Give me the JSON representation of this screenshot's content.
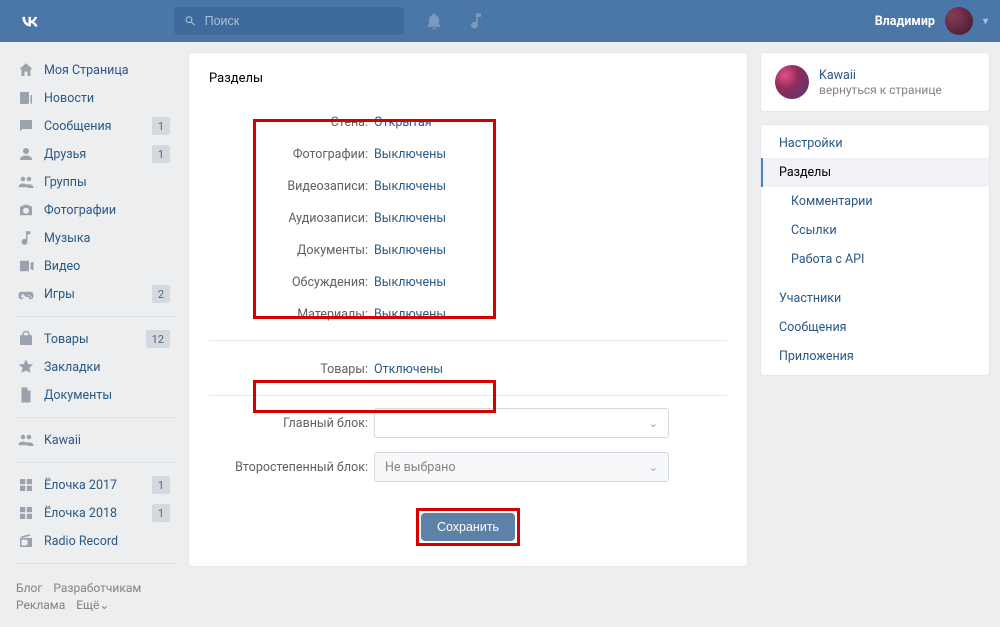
{
  "header": {
    "search_placeholder": "Поиск",
    "user_name": "Владимир"
  },
  "nav": {
    "items": [
      {
        "icon": "home",
        "label": "Моя Страница"
      },
      {
        "icon": "news",
        "label": "Новости"
      },
      {
        "icon": "msg",
        "label": "Сообщения",
        "badge": "1"
      },
      {
        "icon": "friends",
        "label": "Друзья",
        "badge": "1"
      },
      {
        "icon": "groups",
        "label": "Группы"
      },
      {
        "icon": "photo",
        "label": "Фотографии"
      },
      {
        "icon": "music",
        "label": "Музыка"
      },
      {
        "icon": "video",
        "label": "Видео"
      },
      {
        "icon": "games",
        "label": "Игры",
        "badge": "2"
      }
    ],
    "items2": [
      {
        "icon": "bag",
        "label": "Товары",
        "badge": "12"
      },
      {
        "icon": "star",
        "label": "Закладки"
      },
      {
        "icon": "doc",
        "label": "Документы"
      }
    ],
    "items3": [
      {
        "icon": "groups",
        "label": "Kawaii"
      }
    ],
    "items4": [
      {
        "icon": "app",
        "label": "Ёлочка 2017",
        "badge": "1"
      },
      {
        "icon": "app",
        "label": "Ёлочка 2018",
        "badge": "1"
      },
      {
        "icon": "radio",
        "label": "Radio Record"
      }
    ],
    "footer": [
      "Блог",
      "Разработчикам",
      "Реклама",
      "Ещё⌄"
    ]
  },
  "main": {
    "title": "Разделы",
    "settings": [
      {
        "label": "Стена:",
        "value": "Открытая"
      },
      {
        "label": "Фотографии:",
        "value": "Выключены"
      },
      {
        "label": "Видеозаписи:",
        "value": "Выключены"
      },
      {
        "label": "Аудиозаписи:",
        "value": "Выключены"
      },
      {
        "label": "Документы:",
        "value": "Выключены"
      },
      {
        "label": "Обсуждения:",
        "value": "Выключены"
      },
      {
        "label": "Материалы:",
        "value": "Выключены"
      }
    ],
    "goods": {
      "label": "Товары:",
      "value": "Отключены"
    },
    "main_block_label": "Главный блок:",
    "secondary_block_label": "Второстепенный блок:",
    "secondary_placeholder": "Не выбрано",
    "save_label": "Сохранить"
  },
  "side": {
    "profile_name": "Kawaii",
    "profile_sub": "вернуться к странице",
    "menu": [
      {
        "t": "item",
        "label": "Настройки"
      },
      {
        "t": "active",
        "label": "Разделы"
      },
      {
        "t": "sub",
        "label": "Комментарии"
      },
      {
        "t": "sub",
        "label": "Ссылки"
      },
      {
        "t": "sub",
        "label": "Работа с API"
      },
      {
        "t": "gap"
      },
      {
        "t": "item",
        "label": "Участники"
      },
      {
        "t": "item",
        "label": "Сообщения"
      },
      {
        "t": "item",
        "label": "Приложения"
      }
    ]
  }
}
